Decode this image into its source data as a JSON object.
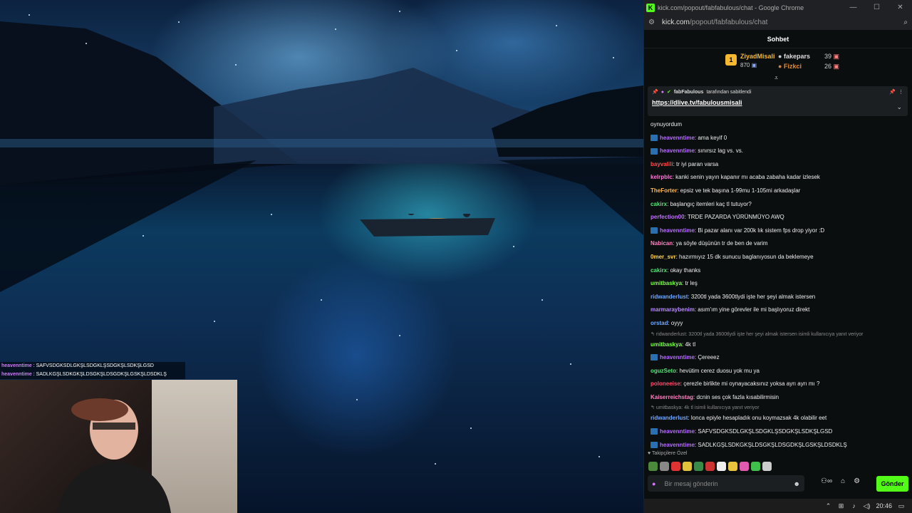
{
  "window": {
    "title": "kick.com/popout/fabfabulous/chat - Google Chrome",
    "url_host": "kick.com",
    "url_path": "/popout/fabfabulous/chat"
  },
  "chat": {
    "header": "Sohbet",
    "leaderboard": {
      "first_rank": "1",
      "first_name": "ZiyadMisali",
      "first_count": "870",
      "second_name": "fakepars",
      "second_count": "39",
      "third_name": "Fizkci",
      "third_count": "26"
    },
    "pinned": {
      "user": "fabFabulous",
      "suffix": "tarafından sabitlendi",
      "link": "https://dlive.tv/fabulousmisali"
    },
    "messages": [
      {
        "user": "",
        "text": "oynuyordum",
        "color": "#eeeeee",
        "badge": false
      },
      {
        "user": "heavenntime",
        "text": ": ama keyif 0",
        "color": "#b56cff",
        "badge": true
      },
      {
        "user": "heavenntime",
        "text": ": sınırsız lag vs. vs.",
        "color": "#b56cff",
        "badge": true
      },
      {
        "user": "bayvalili",
        "text": ": tr iyi paran varsa",
        "color": "#ff4d4d",
        "badge": false
      },
      {
        "user": "kelrpblc",
        "text": ": kanki senin yayın kapanır mı acaba zabaha kadar izlesek",
        "color": "#ff7ad9",
        "badge": false
      },
      {
        "user": "TheForter",
        "text": ": epsiz ve tek başına 1-99mu 1-105mi arkadaşlar",
        "color": "#ffb84d",
        "badge": false
      },
      {
        "user": "cakirx",
        "text": ": başlangıç itemleri kaç tl tutuyor?",
        "color": "#59e07a",
        "badge": false
      },
      {
        "user": "perfection00",
        "text": ": TRDE PAZARDA YÜRÜNMÜYO AWQ",
        "color": "#c070ff",
        "badge": false
      },
      {
        "user": "heavenntime",
        "text": ": Bi pazar alanı var 200k lık sistem fps drop yiyor :D",
        "color": "#b56cff",
        "badge": true
      },
      {
        "user": "Nabican",
        "text": ": ya söyle düşünün tr de ben de varim",
        "color": "#ff80c0",
        "badge": false
      },
      {
        "user": "0mer_svr",
        "text": ": hazırmıyız 15 dk sunucu baglanıyosun da beklemeye",
        "color": "#ffd24d",
        "badge": false
      },
      {
        "user": "cakirx",
        "text": ": okay thanks",
        "color": "#59e07a",
        "badge": false
      },
      {
        "user": "umitbaskya",
        "text": ": tr leş",
        "color": "#7dff4d",
        "badge": false
      },
      {
        "user": "ridwanderlust",
        "text": ": 3200tl yada 3600tlydi işte her şeyi almak istersen",
        "color": "#6fa8ff",
        "badge": false
      },
      {
        "user": "marmaraybenim",
        "text": ": asım'ım yine görevler ile mi başlıyoruz direkt",
        "color": "#b98aff",
        "badge": false
      },
      {
        "user": "orstad",
        "text": ": oyyy",
        "color": "#6fa8ff",
        "badge": false
      }
    ],
    "reply1": "ridwanderlust: 3200tl yada 3600tlydi işte her şeyi almak istersen isimli kullanıcıya yanıt veriyor",
    "messages2": [
      {
        "user": "umitbaskya",
        "text": ": 4k tl",
        "color": "#7dff4d",
        "badge": false
      },
      {
        "user": "heavenntime",
        "text": ": Çereeez",
        "color": "#b56cff",
        "badge": true
      },
      {
        "user": "oguzSeto",
        "text": ": hevütim cerez duosu yok mu ya",
        "color": "#59e07a",
        "badge": false
      },
      {
        "user": "poloneeise",
        "text": ": çerezle birlikte mi oynayacaksınız yoksa ayrı ayrı mı ?",
        "color": "#ff4d6d",
        "badge": false
      },
      {
        "user": "Kaiserreichstag",
        "text": ": dcnin ses çok fazla kısabilirmisin",
        "color": "#ff80c0",
        "badge": false
      }
    ],
    "reply2": "umitbaskya: 4k tl isimli kullanıcıya yanıt veriyor",
    "messages3": [
      {
        "user": "ridwanderlust",
        "text": ": lonca epiyle hesapladık onu koymazsak 4k olabilir eet",
        "color": "#6fa8ff",
        "badge": false
      },
      {
        "user": "heavenntime",
        "text": ": SAFVSDGKSDLGKŞLSDGKLŞSDGKŞLSDKŞLGSD",
        "color": "#b56cff",
        "badge": true
      },
      {
        "user": "heavenntime",
        "text": ": SADLKGŞLSDKGKŞLDSGKŞLDSGDKŞLGSKŞLDSDKLŞ",
        "color": "#b56cff",
        "badge": true
      }
    ],
    "followers_label": "Takipçilere Özel",
    "composer_placeholder": "Bir mesaj gönderin",
    "send_label": "Gönder"
  },
  "overlay_chat": [
    {
      "user": "heavenntime",
      "text": " : SAFVSDGKSDLGKŞLSDGKLŞSDGKŞLSDKŞLGSD"
    },
    {
      "user": "heavenntime",
      "text": " : SADLKGŞLSDKGKŞLDSGKŞLDSGDKŞLGSKŞLDSDKLŞ"
    }
  ],
  "taskbar": {
    "time": "20:46"
  },
  "colors": {
    "accent": "#53fc18",
    "bg": "#0b0e0f"
  }
}
